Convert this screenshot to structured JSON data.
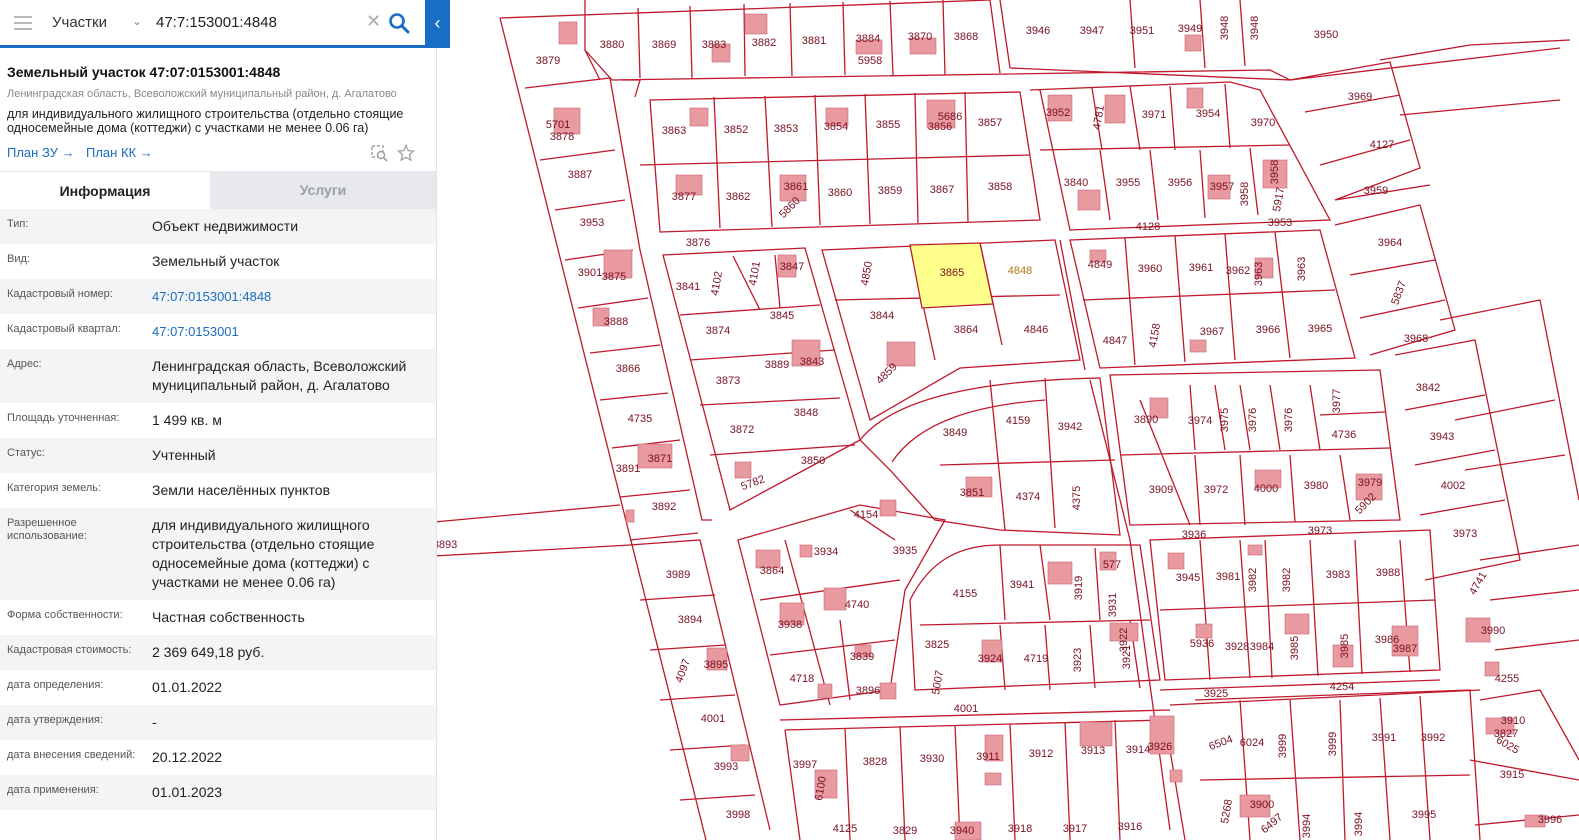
{
  "search": {
    "layer_label": "Участки",
    "query": "47:7:153001:4848"
  },
  "object": {
    "title": "Земельный участок 47:07:0153001:4848",
    "address": "Ленинградская область, Всеволожский муниципальный район, д. Агалатово",
    "usage_line1": "для индивидуального жилищного строительства (отдельно стоящие",
    "usage_line2": "односемейные дома (коттеджи) с участками не менее 0.06 га)",
    "plan_zu": "План ЗУ →",
    "plan_kk": "План КК →"
  },
  "tabs": {
    "info": "Информация",
    "services": "Услуги"
  },
  "properties": [
    {
      "key": "Тип:",
      "value": "Объект недвижимости",
      "link": false
    },
    {
      "key": "Вид:",
      "value": "Земельный участок",
      "link": false
    },
    {
      "key": "Кадастровый номер:",
      "value": "47:07:0153001:4848",
      "link": true
    },
    {
      "key": "Кадастровый квартал:",
      "value": "47:07:0153001",
      "link": true
    },
    {
      "key": "Адрес:",
      "value": "Ленинградская область, Всеволожский муниципальный район, д. Агалатово",
      "link": false
    },
    {
      "key": "Площадь уточненная:",
      "value": "1 499 кв. м",
      "link": false
    },
    {
      "key": "Статус:",
      "value": "Учтенный",
      "link": false
    },
    {
      "key": "Категория земель:",
      "value": "Земли населённых пунктов",
      "link": false
    },
    {
      "key": "Разрешенное использование:",
      "value": "для индивидуального жилищного строительства (отдельно стоящие односемейные дома (коттеджи) с участками не менее 0.06 га)",
      "link": false
    },
    {
      "key": "Форма собственности:",
      "value": "Частная собственность",
      "link": false
    },
    {
      "key": "Кадастровая стоимость:",
      "value": "2 369 649,18 руб.",
      "link": false
    },
    {
      "key": "дата определения:",
      "value": "01.01.2022",
      "link": false
    },
    {
      "key": "дата утверждения:",
      "value": "-",
      "link": false
    },
    {
      "key": "дата внесения сведений:",
      "value": "20.12.2022",
      "link": false
    },
    {
      "key": "дата применения:",
      "value": "01.01.2023",
      "link": false
    }
  ],
  "colors": {
    "parcel_line": "#c0182b",
    "parcel_label": "#7a1020",
    "building_fill": "#e89aa0",
    "selected_fill": "#ffff8c",
    "accent": "#1a6dc4"
  },
  "map": {
    "selected_parcel": "4848",
    "parcel_labels": [
      "3879",
      "3880",
      "3869",
      "3883",
      "3882",
      "3881",
      "3884",
      "5958",
      "3870",
      "3868",
      "3946",
      "3947",
      "3951",
      "3949",
      "3948",
      "3948",
      "3950",
      "5701",
      "3878",
      "3863",
      "3852",
      "3853",
      "3854",
      "3855",
      "5686",
      "3856",
      "3857",
      "3952",
      "4781",
      "3971",
      "3954",
      "3970",
      "3969",
      "4127",
      "3887",
      "3877",
      "3862",
      "3861",
      "5860",
      "3860",
      "3859",
      "3867",
      "3858",
      "3840",
      "3955",
      "3956",
      "3957",
      "3958",
      "3958",
      "5917",
      "3959",
      "4128",
      "3953",
      "3953",
      "3876",
      "3841",
      "4102",
      "4101",
      "3847",
      "4850",
      "3865",
      "4848",
      "4849",
      "3960",
      "3961",
      "3962",
      "3963",
      "3963",
      "3964",
      "3901",
      "3875",
      "5837",
      "3888",
      "3874",
      "3845",
      "3844",
      "3864",
      "4846",
      "4847",
      "4158",
      "3967",
      "3966",
      "3965",
      "3968",
      "3889",
      "3843",
      "4859",
      "3866",
      "3873",
      "3842",
      "3890",
      "3974",
      "3975",
      "3976",
      "3976",
      "3977",
      "4736",
      "4735",
      "3872",
      "3848",
      "3849",
      "4159",
      "3942",
      "3943",
      "3891",
      "3871",
      "5782",
      "3850",
      "3851",
      "4374",
      "4375",
      "3909",
      "3972",
      "4000",
      "3980",
      "3979",
      "5902",
      "4002",
      "3892",
      "4154",
      "3936",
      "3973",
      "3973",
      "3893",
      "3864",
      "3934",
      "3935",
      "3945",
      "3981",
      "3982",
      "3982",
      "3983",
      "3988",
      "3989",
      "4155",
      "3941",
      "3919",
      "577",
      "3931",
      "4741",
      "4740",
      "3894",
      "3938",
      "3825",
      "3924",
      "4719",
      "3923",
      "3922",
      "3921",
      "5936",
      "3928",
      "3984",
      "3985",
      "3985",
      "3986",
      "3987",
      "3990",
      "4097",
      "3895",
      "3839",
      "5007",
      "4255",
      "4718",
      "3896",
      "3925",
      "4254",
      "4001",
      "4001",
      "3910",
      "3827",
      "6025",
      "6504",
      "6024",
      "3999",
      "3999",
      "3991",
      "3992",
      "3993",
      "3997",
      "3828",
      "3930",
      "3911",
      "3912",
      "3913",
      "3914",
      "3926",
      "3915",
      "6100",
      "3900",
      "5268",
      "6497",
      "3994",
      "3994",
      "3995",
      "3996",
      "3998",
      "4125",
      "3829",
      "3940",
      "3918",
      "3917",
      "3916",
      "3927",
      "3929"
    ]
  }
}
